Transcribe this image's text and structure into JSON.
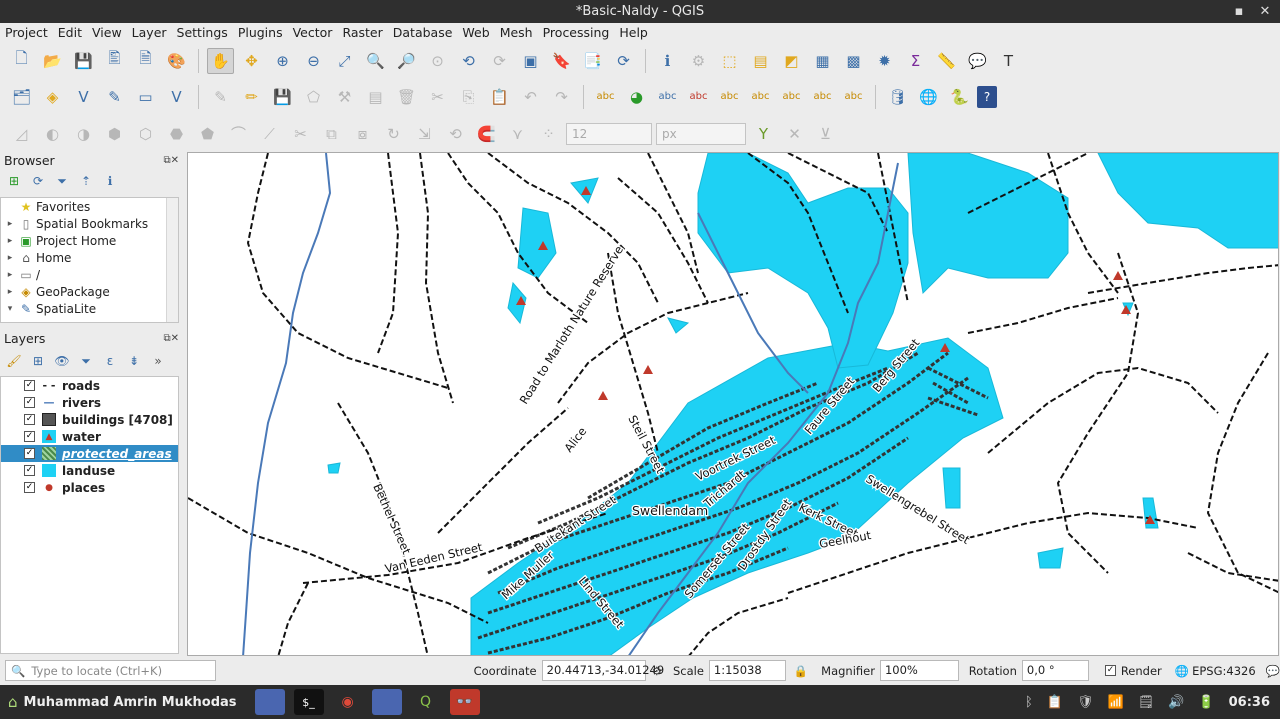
{
  "window": {
    "title": "*Basic-Naldy - QGIS"
  },
  "menu": [
    "Project",
    "Edit",
    "View",
    "Layer",
    "Settings",
    "Plugins",
    "Vector",
    "Raster",
    "Database",
    "Web",
    "Mesh",
    "Processing",
    "Help"
  ],
  "toolbar3": {
    "size_value": "12",
    "unit_value": "px"
  },
  "browser": {
    "title": "Browser",
    "items": [
      {
        "label": "Favorites",
        "icon": "star-icon"
      },
      {
        "label": "Spatial Bookmarks",
        "icon": "bookmark-icon"
      },
      {
        "label": "Project Home",
        "icon": "project-home-icon"
      },
      {
        "label": "Home",
        "icon": "home-folder-icon"
      },
      {
        "label": "/",
        "icon": "folder-icon"
      },
      {
        "label": "GeoPackage",
        "icon": "geopackage-icon"
      },
      {
        "label": "SpatiaLite",
        "icon": "spatialite-icon"
      }
    ]
  },
  "layers": {
    "title": "Layers",
    "items": [
      {
        "label": "roads",
        "checked": true,
        "icon": "dashed-line-icon"
      },
      {
        "label": "rivers",
        "checked": true,
        "icon": "line-icon"
      },
      {
        "label": "buildings [4708]",
        "checked": true,
        "icon": "polygon-icon"
      },
      {
        "label": "water",
        "checked": true,
        "icon": "triangle-marker-icon"
      },
      {
        "label": "protected_areas",
        "checked": true,
        "icon": "hatched-polygon-icon",
        "selected": true
      },
      {
        "label": "landuse",
        "checked": true,
        "icon": "cyan-polygon-icon"
      },
      {
        "label": "places",
        "checked": true,
        "icon": "point-icon"
      }
    ]
  },
  "map": {
    "labels": [
      "Road to Marloth Nature Reserve",
      "Alice",
      "Steil Street",
      "Voortrek Street",
      "Faure Street",
      "Berg Street",
      "Swellendam",
      "Trichardt",
      "Buitekant Street",
      "Bethel Street",
      "Van Eeden Street",
      "Mike Muller",
      "Lind Street",
      "Somerset Street",
      "Drostdy Street",
      "Kerk Street",
      "Geelhout",
      "Swellengrebel Street"
    ],
    "colors": {
      "landuse": "#1ed1f4",
      "roads": "#1a1a1a",
      "rivers": "#4a79b8",
      "water_marker": "#c0392b",
      "buildings": "#444444"
    }
  },
  "status": {
    "locator_placeholder": "Type to locate (Ctrl+K)",
    "coordinate_label": "Coordinate",
    "coordinate_value": "20.44713,-34.01249",
    "scale_label": "Scale",
    "scale_value": "1:15038",
    "magnifier_label": "Magnifier",
    "magnifier_value": "100%",
    "rotation_label": "Rotation",
    "rotation_value": "0,0 °",
    "render_label": "Render",
    "crs": "EPSG:4326"
  },
  "taskbar": {
    "user": "Muhammad Amrin Mukhodas",
    "clock": "06:36"
  }
}
